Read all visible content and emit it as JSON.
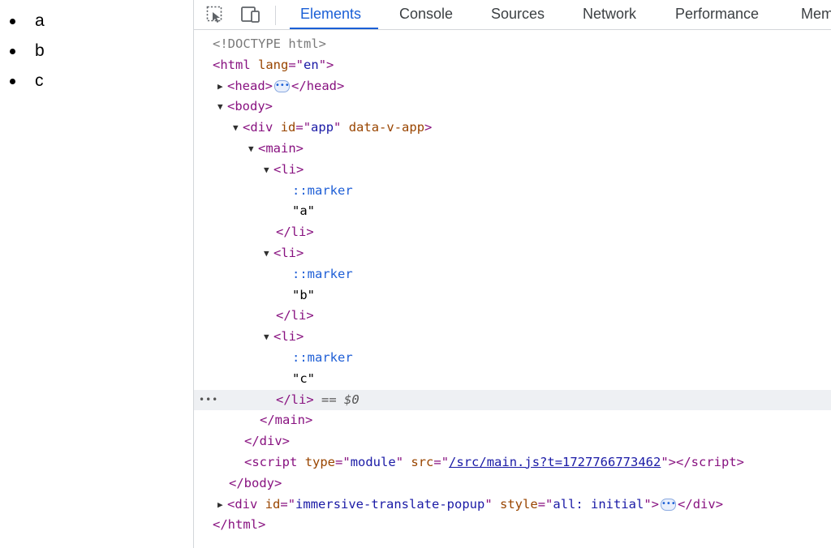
{
  "page": {
    "list_items": [
      "a",
      "b",
      "c"
    ]
  },
  "devtools": {
    "tabs": [
      {
        "label": "Elements",
        "active": true
      },
      {
        "label": "Console"
      },
      {
        "label": "Sources"
      },
      {
        "label": "Network"
      },
      {
        "label": "Performance"
      },
      {
        "label": "Mem"
      }
    ],
    "icons": {
      "inspect": "inspect-element-icon",
      "device": "device-toolbar-icon"
    },
    "dom": {
      "doctype": "<!DOCTYPE html>",
      "html_tag": "html",
      "lang_attr": "lang",
      "lang_val": "en",
      "head_tag": "head",
      "body_tag": "body",
      "div_tag": "div",
      "id_attr": "id",
      "app_id": "app",
      "data_v_attr": "data-v-app",
      "main_tag": "main",
      "li_tag": "li",
      "marker": "::marker",
      "text_a": "\"a\"",
      "text_b": "\"b\"",
      "text_c": "\"c\"",
      "selected_suffix": " == ",
      "dollar": "$0",
      "script_tag": "script",
      "type_attr": "type",
      "type_val": "module",
      "src_attr": "src",
      "src_val": "/src/main.js?t=1727766773462",
      "popup_id": "immersive-translate-popup",
      "style_attr": "style",
      "style_val": "all: initial",
      "row_dots": "•••"
    }
  }
}
